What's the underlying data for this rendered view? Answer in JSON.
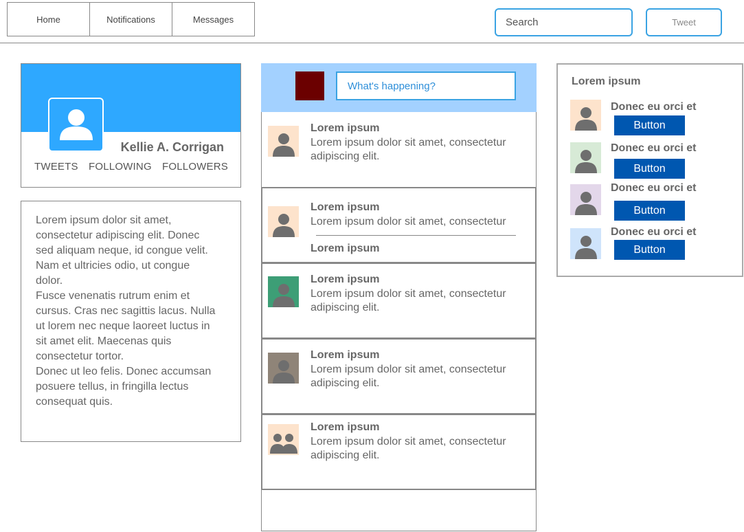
{
  "nav": {
    "home": "Home",
    "notifications": "Notifications",
    "messages": "Messages"
  },
  "search": {
    "placeholder": "Search"
  },
  "tweet_button": "Tweet",
  "profile": {
    "name": "Kellie A. Corrigan",
    "tweets": "TWEETS",
    "following": "FOLLOWING",
    "followers": "FOLLOWERS",
    "bio": [
      "Lorem ipsum dolor sit amet,",
      "consectetur adipiscing elit. Donec",
      "sed aliquam neque, id congue velit.",
      "Nam et ultricies odio, ut congue",
      "dolor.",
      "Fusce venenatis rutrum enim et",
      "cursus. Cras nec sagittis lacus. Nulla",
      "ut lorem nec neque laoreet luctus in",
      "sit amet elit. Maecenas quis",
      "consectetur tortor.",
      "Donec ut leo felis. Donec accumsan",
      "posuere tellus, in fringilla lectus",
      "consequat quis."
    ]
  },
  "compose": {
    "placeholder": "What's happening?",
    "avatar_color": "#6b0000"
  },
  "feed": [
    {
      "title": "Lorem ipsum",
      "text": "Lorem ipsum dolor sit amet, consectetur adipiscing elit.",
      "avatar_bg": "#fde3cc",
      "icon": "user-icon"
    },
    {
      "title": "Lorem ipsum",
      "text": "Lorem ipsum dolor sit amet, consectetur",
      "reply_title": "Lorem ipsum",
      "avatar_bg": "#fde3cc",
      "icon": "user-icon"
    },
    {
      "title": "Lorem ipsum",
      "text": "Lorem ipsum dolor sit amet, consectetur adipiscing elit.",
      "avatar_bg": "#3d9e76",
      "icon": "user-icon"
    },
    {
      "title": "Lorem ipsum",
      "text": "Lorem ipsum dolor sit amet, consectetur adipiscing elit.",
      "avatar_bg": "#8f8478",
      "icon": "user-icon"
    },
    {
      "title": "Lorem ipsum",
      "text": "Lorem ipsum dolor sit amet, consectetur adipiscing elit.",
      "avatar_bg": "#fde3cc",
      "icon": "users-icon"
    }
  ],
  "who_to_follow": {
    "title": "Lorem ipsum",
    "items": [
      {
        "name": "Donec eu orci et",
        "button": "Button",
        "avatar_bg": "#fde3cc"
      },
      {
        "name": "Donec eu orci et",
        "button": "Button",
        "avatar_bg": "#d7ead6"
      },
      {
        "name": "Donec eu orci et",
        "button": "Button",
        "avatar_bg": "#e3d7ea"
      },
      {
        "name": "Donec eu orci et",
        "button": "Button",
        "avatar_bg": "#cfe4fb"
      }
    ]
  },
  "colors": {
    "accent": "#2ea8ff",
    "border_blue": "#3aa3e3",
    "button": "#0057b0",
    "compose_bg": "#a3d1ff",
    "avatar_icon": "#6e6e6e"
  }
}
